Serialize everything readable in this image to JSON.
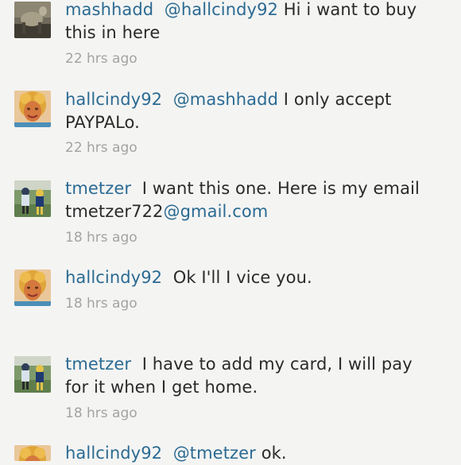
{
  "comments": [
    {
      "username": "mashhadd",
      "mention": "@hallcindy92",
      "text": "Hi i want to buy this in here",
      "time": "22 hrs ago",
      "avatar": "mashhadd-avatar"
    },
    {
      "username": "hallcindy92",
      "mention": "@mashhadd",
      "text": "I only accept PAYPALo.",
      "time": "22 hrs ago",
      "avatar": "hallcindy92-avatar"
    },
    {
      "username": "tmetzer",
      "text_before_link": "I want this one.  Here is my email tmetzer722",
      "link": "@gmail.com",
      "time": "18 hrs ago",
      "avatar": "tmetzer-avatar"
    },
    {
      "username": "hallcindy92",
      "text": "Ok I'll I vice you.",
      "time": "18 hrs ago",
      "avatar": "hallcindy92-avatar"
    },
    {
      "username": "tmetzer",
      "text": "I have to add my card, I will pay for it when I get home.",
      "time": "18 hrs ago",
      "avatar": "tmetzer-avatar"
    },
    {
      "username": "hallcindy92",
      "mention": "@tmetzer",
      "text": "ok.",
      "avatar": "hallcindy92-avatar"
    }
  ],
  "colors": {
    "background": "#f4f4f3",
    "username": "#2b6a92",
    "text": "#2a2a2a",
    "timestamp": "#a3a3a3"
  }
}
